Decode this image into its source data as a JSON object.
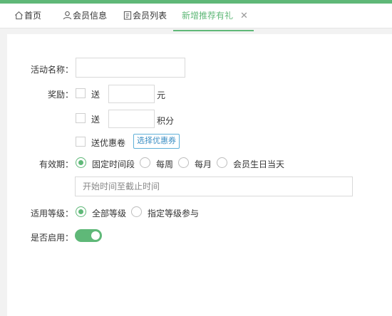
{
  "tabs": [
    {
      "label": "首页",
      "icon": "home-icon"
    },
    {
      "label": "会员信息",
      "icon": "user-icon"
    },
    {
      "label": "会员列表",
      "icon": "list-doc-icon"
    },
    {
      "label": "新增推荐有礼",
      "icon": ""
    }
  ],
  "tab_close_glyph": "✕",
  "form": {
    "activity_name_label": "活动名称：",
    "activity_name_value": "",
    "reward_label": "奖励：",
    "reward_gift_text": "送",
    "reward_yuan_unit": "元",
    "reward_points_text": "送",
    "reward_points_unit": "积分",
    "reward_coupon_text": "送优惠卷",
    "select_coupon_button": "选择优惠券",
    "validity_label": "有效期：",
    "validity_options": [
      "固定时间段",
      "每周",
      "每月",
      "会员生日当天"
    ],
    "validity_selected": "固定时间段",
    "time_range_placeholder": "开始时间至截止时间",
    "level_label": "适用等级：",
    "level_options": [
      "全部等级",
      "指定等级参与"
    ],
    "level_selected": "全部等级",
    "enabled_label": "是否启用：",
    "enabled": true
  },
  "colors": {
    "accent": "#5fb878",
    "button_border": "#5fb0d8"
  }
}
